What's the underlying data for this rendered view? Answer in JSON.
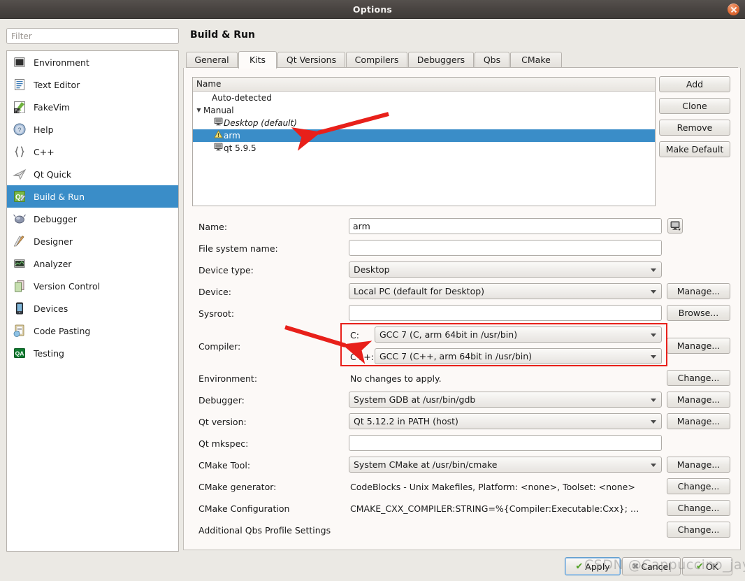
{
  "window": {
    "title": "Options",
    "close_icon": "close-icon"
  },
  "search": {
    "placeholder": "Filter",
    "value": ""
  },
  "sidebar": {
    "items": [
      {
        "label": "Environment",
        "icon": "environment-icon",
        "selected": false
      },
      {
        "label": "Text Editor",
        "icon": "text-editor-icon",
        "selected": false
      },
      {
        "label": "FakeVim",
        "icon": "fakevim-icon",
        "selected": false
      },
      {
        "label": "Help",
        "icon": "help-icon",
        "selected": false
      },
      {
        "label": "C++",
        "icon": "cpp-icon",
        "selected": false
      },
      {
        "label": "Qt Quick",
        "icon": "qt-quick-icon",
        "selected": false
      },
      {
        "label": "Build & Run",
        "icon": "build-and-run-icon",
        "selected": true
      },
      {
        "label": "Debugger",
        "icon": "debugger-icon",
        "selected": false
      },
      {
        "label": "Designer",
        "icon": "designer-icon",
        "selected": false
      },
      {
        "label": "Analyzer",
        "icon": "analyzer-icon",
        "selected": false
      },
      {
        "label": "Version Control",
        "icon": "version-control-icon",
        "selected": false
      },
      {
        "label": "Devices",
        "icon": "devices-icon",
        "selected": false
      },
      {
        "label": "Code Pasting",
        "icon": "code-pasting-icon",
        "selected": false
      },
      {
        "label": "Testing",
        "icon": "testing-icon",
        "selected": false
      }
    ]
  },
  "page": {
    "title": "Build & Run"
  },
  "tabs": [
    {
      "label": "General",
      "active": false
    },
    {
      "label": "Kits",
      "active": true
    },
    {
      "label": "Qt Versions",
      "active": false
    },
    {
      "label": "Compilers",
      "active": false
    },
    {
      "label": "Debuggers",
      "active": false
    },
    {
      "label": "Qbs",
      "active": false
    },
    {
      "label": "CMake",
      "active": false
    }
  ],
  "kit_tree": {
    "header": "Name",
    "rows": [
      {
        "label": "Auto-detected",
        "indent": 1,
        "expander": "",
        "icon": "",
        "italic": false,
        "selected": false
      },
      {
        "label": "Manual",
        "indent": 0,
        "expander": "▼",
        "icon": "",
        "italic": false,
        "selected": false
      },
      {
        "label": "Desktop (default)",
        "indent": 2,
        "expander": "",
        "icon": "monitor-icon",
        "italic": true,
        "selected": false
      },
      {
        "label": "arm",
        "indent": 2,
        "expander": "",
        "icon": "warning-icon",
        "italic": false,
        "selected": true
      },
      {
        "label": "qt 5.9.5",
        "indent": 2,
        "expander": "",
        "icon": "monitor-icon",
        "italic": false,
        "selected": false
      }
    ]
  },
  "tree_buttons": [
    {
      "label": "Add"
    },
    {
      "label": "Clone"
    },
    {
      "label": "Remove"
    },
    {
      "label": "Make Default"
    }
  ],
  "form": {
    "name": {
      "label": "Name:",
      "value": "arm",
      "type": "input",
      "side_icon": "monitor-dropdown-icon"
    },
    "file_system_name": {
      "label": "File system name:",
      "value": "",
      "type": "input"
    },
    "device_type": {
      "label": "Device type:",
      "value": "Desktop",
      "type": "combo"
    },
    "device": {
      "label": "Device:",
      "value": "Local PC (default for Desktop)",
      "type": "combo",
      "button": "Manage..."
    },
    "sysroot": {
      "label": "Sysroot:",
      "value": "",
      "type": "input",
      "button": "Browse..."
    },
    "compiler": {
      "label": "Compiler:",
      "button": "Manage...",
      "c": {
        "label": "C:",
        "value": "GCC 7 (C, arm 64bit in /usr/bin)"
      },
      "cxx": {
        "label": "C++:",
        "value": "GCC 7 (C++, arm 64bit in /usr/bin)"
      }
    },
    "environment": {
      "label": "Environment:",
      "value": "No changes to apply.",
      "type": "static",
      "button": "Change..."
    },
    "debugger": {
      "label": "Debugger:",
      "value": "System GDB at /usr/bin/gdb",
      "type": "combo",
      "button": "Manage..."
    },
    "qt_version": {
      "label": "Qt version:",
      "value": "Qt 5.12.2 in PATH (host)",
      "type": "combo",
      "button": "Manage..."
    },
    "qt_mkspec": {
      "label": "Qt mkspec:",
      "value": "",
      "type": "input"
    },
    "cmake_tool": {
      "label": "CMake Tool:",
      "value": "System CMake at /usr/bin/cmake",
      "type": "combo",
      "button": "Manage..."
    },
    "cmake_generator": {
      "label": "CMake generator:",
      "value": "CodeBlocks - Unix Makefiles, Platform: <none>, Toolset: <none>",
      "type": "static",
      "button": "Change..."
    },
    "cmake_config": {
      "label": "CMake Configuration",
      "value": "CMAKE_CXX_COMPILER:STRING=%{Compiler:Executable:Cxx}; …",
      "type": "static",
      "button": "Change..."
    },
    "qbs_profile": {
      "label": "Additional Qbs Profile Settings",
      "value": "",
      "type": "static",
      "button": "Change..."
    }
  },
  "footer": {
    "apply": "Apply",
    "cancel": "Cancel",
    "ok": "OK"
  },
  "watermark": {
    "text": "CSDN @Cappuccino_jay"
  },
  "colors": {
    "selection_blue": "#3a8dc8",
    "annotation_red": "#e8201a",
    "window_bg": "#ebe9e4",
    "pane_bg": "#fcf9f7"
  }
}
